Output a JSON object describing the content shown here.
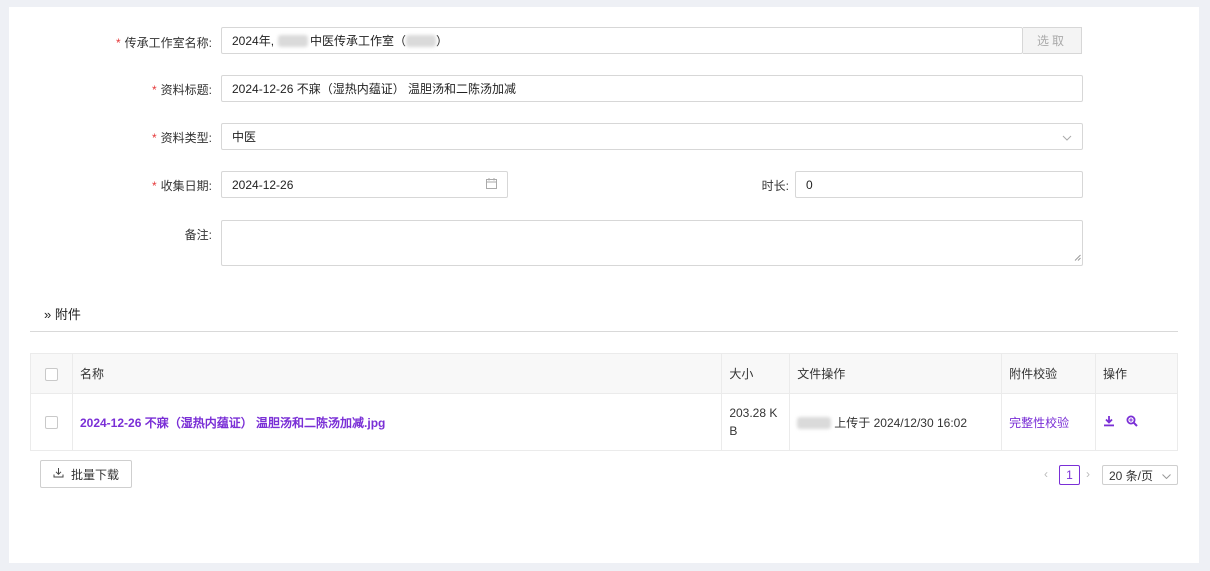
{
  "form": {
    "studio_label": "传承工作室名称",
    "studio_value_prefix": "2024年,",
    "studio_value_mid": "中医传承工作室（",
    "studio_value_suffix": "）",
    "pick_button": "选取",
    "title_label": "资料标题",
    "title_value": "2024-12-26 不寐（湿热内蕴证） 温胆汤和二陈汤加减",
    "type_label": "资料类型",
    "type_value": "中医",
    "date_label": "收集日期",
    "date_value": "2024-12-26",
    "duration_label": "时长",
    "duration_value": "0",
    "remark_label": "备注",
    "remark_value": "",
    "colon": ":"
  },
  "attachments": {
    "section_title": "» 附件",
    "columns": [
      "名称",
      "大小",
      "文件操作",
      "附件校验",
      "操作"
    ],
    "rows": [
      {
        "name": "2024-12-26 不寐（湿热内蕴证） 温胆汤和二陈汤加减.jpg",
        "size": "203.28 KB",
        "upload_text": "上传于 2024/12/30 16:02",
        "verify": "完整性校验"
      }
    ]
  },
  "footer": {
    "batch_download": "批量下载",
    "current_page": "1",
    "page_size": "20 条/页"
  },
  "icons": {
    "download": "download-icon",
    "preview": "zoom-icon",
    "calendar": "calendar-icon"
  },
  "colors": {
    "accent": "#7a2fd6",
    "required": "#e5393a"
  }
}
